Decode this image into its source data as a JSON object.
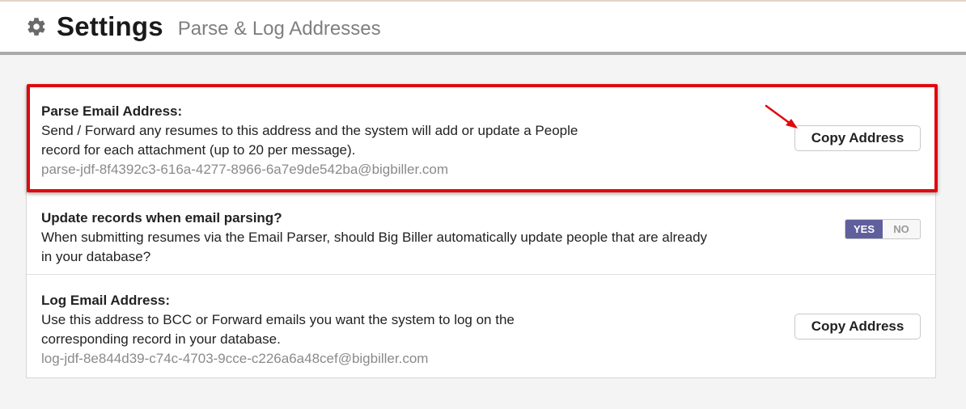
{
  "header": {
    "icon": "gear-icon",
    "title": "Settings",
    "subtitle": "Parse & Log Addresses"
  },
  "parse": {
    "label": "Parse Email Address:",
    "description": "Send / Forward any resumes to this address and the system will add or update a People record for each attachment (up to 20 per message).",
    "address": "parse-jdf-8f4392c3-616a-4277-8966-6a7e9de542ba@bigbiller.com",
    "button": "Copy Address"
  },
  "update": {
    "label": "Update records when email parsing?",
    "description": "When submitting resumes via the Email Parser, should Big Biller automatically update people that are already in your database?",
    "toggle": {
      "yes": "YES",
      "no": "NO",
      "selected": "YES"
    }
  },
  "log": {
    "label": "Log Email Address:",
    "description": "Use this address to BCC or Forward emails you want the system to log on the corresponding record in your database.",
    "address": "log-jdf-8e844d39-c74c-4703-9cce-c226a6a48cef@bigbiller.com",
    "button": "Copy Address"
  },
  "colors": {
    "highlight": "#e0080f",
    "toggle_selected": "#5f5f9e",
    "address_text": "#8a8a8a"
  }
}
